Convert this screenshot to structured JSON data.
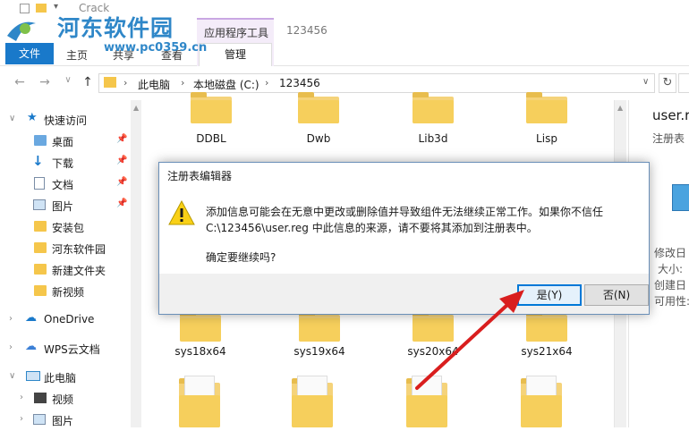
{
  "window": {
    "title": "Crack"
  },
  "watermark": {
    "site_name": "河东软件园",
    "url": "www.pc0359.cn"
  },
  "ribbon": {
    "file_tab": "文件",
    "tabs": [
      "主页",
      "共享",
      "查看"
    ],
    "context_group": "应用程序工具",
    "context_tab": "管理",
    "folder_title": "123456"
  },
  "address": {
    "crumbs": [
      "此电脑",
      "本地磁盘 (C:)",
      "123456"
    ]
  },
  "nav": {
    "quick_access": "快速访问",
    "items": [
      {
        "label": "桌面",
        "icon": "desktop-folder-icon",
        "pinned": true
      },
      {
        "label": "下载",
        "icon": "download-icon",
        "pinned": true
      },
      {
        "label": "文档",
        "icon": "document-icon",
        "pinned": true
      },
      {
        "label": "图片",
        "icon": "pictures-icon",
        "pinned": true
      },
      {
        "label": "安装包",
        "icon": "folder-icon",
        "pinned": false
      },
      {
        "label": "河东软件园",
        "icon": "folder-icon",
        "pinned": false
      },
      {
        "label": "新建文件夹",
        "icon": "folder-icon",
        "pinned": false
      },
      {
        "label": "新视频",
        "icon": "folder-icon",
        "pinned": false
      }
    ],
    "onedrive": "OneDrive",
    "wps": "WPS云文档",
    "this_pc": "此电脑",
    "pc_items": [
      "视频",
      "图片"
    ]
  },
  "files": {
    "row1": [
      "DDBL",
      "Dwb",
      "Lib3d",
      "Lisp"
    ],
    "row2": [
      "sys18x64",
      "sys19x64",
      "sys20x64",
      "sys21x64"
    ]
  },
  "details": {
    "filename": "user.r",
    "type_label": "注册表",
    "modified": "修改日",
    "size": "大小:",
    "created": "创建日",
    "available": "可用性:"
  },
  "dialog": {
    "title": "注册表编辑器",
    "line1": "添加信息可能会在无意中更改或删除值并导致组件无法继续正常工作。如果你不信任",
    "line2": "C:\\123456\\user.reg 中此信息的来源，请不要将其添加到注册表中。",
    "line3": "确定要继续吗?",
    "yes": "是(Y)",
    "no": "否(N)"
  },
  "colors": {
    "accent": "#0078d7",
    "file_tab": "#1979ca",
    "folder": "#f5c64b",
    "arrow": "#d91e1e",
    "watermark": "#2f87c8"
  }
}
